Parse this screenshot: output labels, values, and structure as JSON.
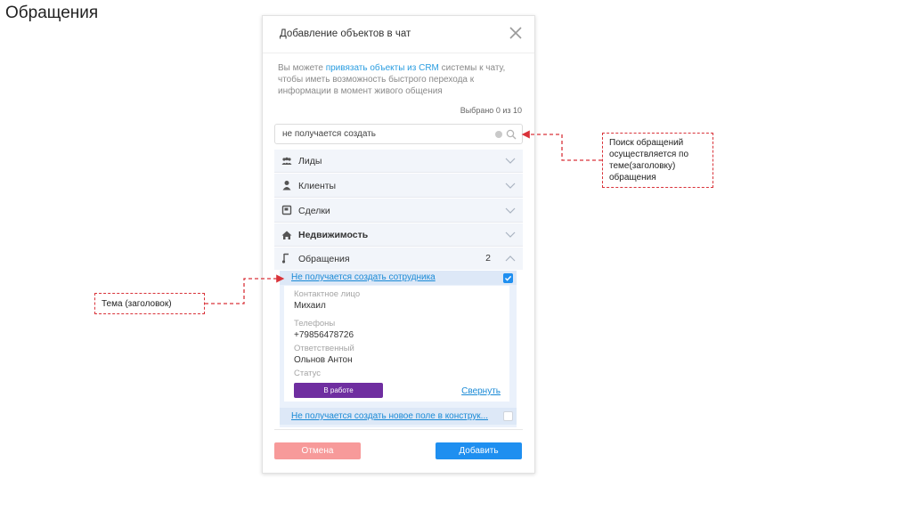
{
  "slide": {
    "title": "Обращения"
  },
  "modal": {
    "title": "Добавление объектов в чат",
    "description_prefix": "Вы можете ",
    "description_link": "привязать объекты из CRM",
    "description_suffix": " системы к чату, чтобы иметь возможность быстрого перехода к информации в момент живого общения",
    "selected_count": "Выбрано 0 из 10",
    "search": {
      "value": "не получается создать"
    },
    "sections": [
      {
        "label": "Лиды",
        "icon": "leads-icon"
      },
      {
        "label": "Клиенты",
        "icon": "client-icon"
      },
      {
        "label": "Сделки",
        "icon": "deals-icon"
      },
      {
        "label": "Недвижимость",
        "icon": "house-icon"
      },
      {
        "label": "Обращения",
        "icon": "requests-icon",
        "count": "2",
        "expanded": true
      }
    ],
    "results": [
      {
        "title": "Не получается создать сотрудника",
        "checked": true,
        "fields": {
          "contact_label": "Контактное лицо",
          "contact_value": "Михаил",
          "phones_label": "Телефоны",
          "phones_value": "+79856478726",
          "responsible_label": "Ответственный",
          "responsible_value": "Ольнов Антон",
          "status_label": "Статус",
          "status_value": "В работе"
        },
        "collapse_label": "Свернуть"
      },
      {
        "title": "Не получается создать новое поле в конструк...",
        "checked": false
      }
    ],
    "buttons": {
      "cancel": "Отмена",
      "add": "Добавить"
    }
  },
  "callouts": {
    "search": "Поиск обращений осуществляется по теме(заголовку) обращения",
    "title": "Тема (заголовок)"
  },
  "colors": {
    "accent": "#1f8ff0",
    "status": "#6f2ea0",
    "cancel": "#f79a9a",
    "callout_border": "#d9333a"
  }
}
